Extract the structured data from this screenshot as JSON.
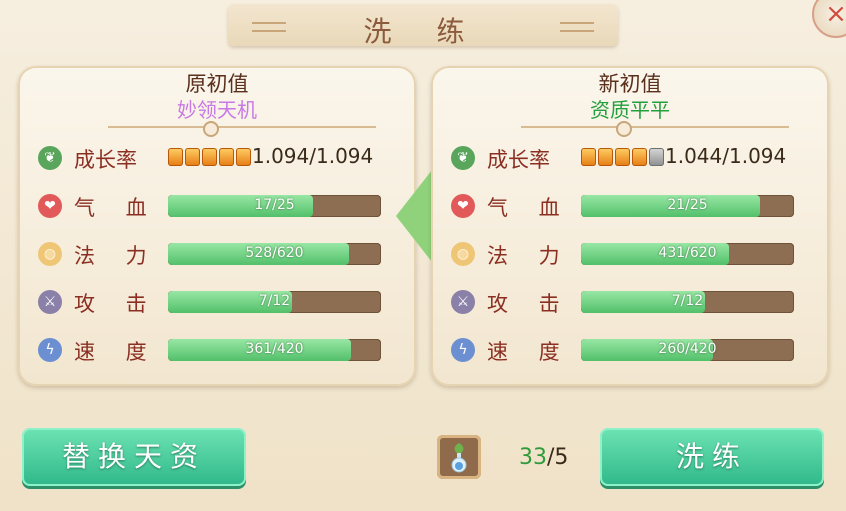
{
  "title": "洗 练",
  "close_label": "×",
  "left_panel": {
    "heading": "原初值",
    "quality": "妙领天机",
    "growth": {
      "label": "成长率",
      "value": "1.094/1.094",
      "filled_blocks": 5,
      "total_blocks": 5
    },
    "stats": [
      {
        "label": "气 血",
        "icon": "heart-icon",
        "text": "17/25",
        "current": 17,
        "max": 25
      },
      {
        "label": "法 力",
        "icon": "mana-icon",
        "text": "528/620",
        "current": 528,
        "max": 620
      },
      {
        "label": "攻 击",
        "icon": "sword-icon",
        "text": "7/12",
        "current": 7,
        "max": 12
      },
      {
        "label": "速 度",
        "icon": "lightning-icon",
        "text": "361/420",
        "current": 361,
        "max": 420
      }
    ]
  },
  "right_panel": {
    "heading": "新初值",
    "quality": "资质平平",
    "growth": {
      "label": "成长率",
      "value": "1.044/1.094",
      "filled_blocks": 4,
      "total_blocks": 5
    },
    "stats": [
      {
        "label": "气 血",
        "icon": "heart-icon",
        "text": "21/25",
        "current": 21,
        "max": 25
      },
      {
        "label": "法 力",
        "icon": "mana-icon",
        "text": "431/620",
        "current": 431,
        "max": 620
      },
      {
        "label": "攻 击",
        "icon": "sword-icon",
        "text": "7/12",
        "current": 7,
        "max": 12
      },
      {
        "label": "速 度",
        "icon": "lightning-icon",
        "text": "260/420",
        "current": 260,
        "max": 420
      }
    ]
  },
  "buttons": {
    "replace": "替换天资",
    "refine": "洗练"
  },
  "item": {
    "icon": "potion-bottle-icon",
    "have": "33",
    "sep_need": "/5"
  },
  "colors": {
    "accent_green": "#2fb88a",
    "bar_fill": "#52c06a",
    "quality_left": "#c879e6",
    "quality_right": "#22a03e"
  }
}
